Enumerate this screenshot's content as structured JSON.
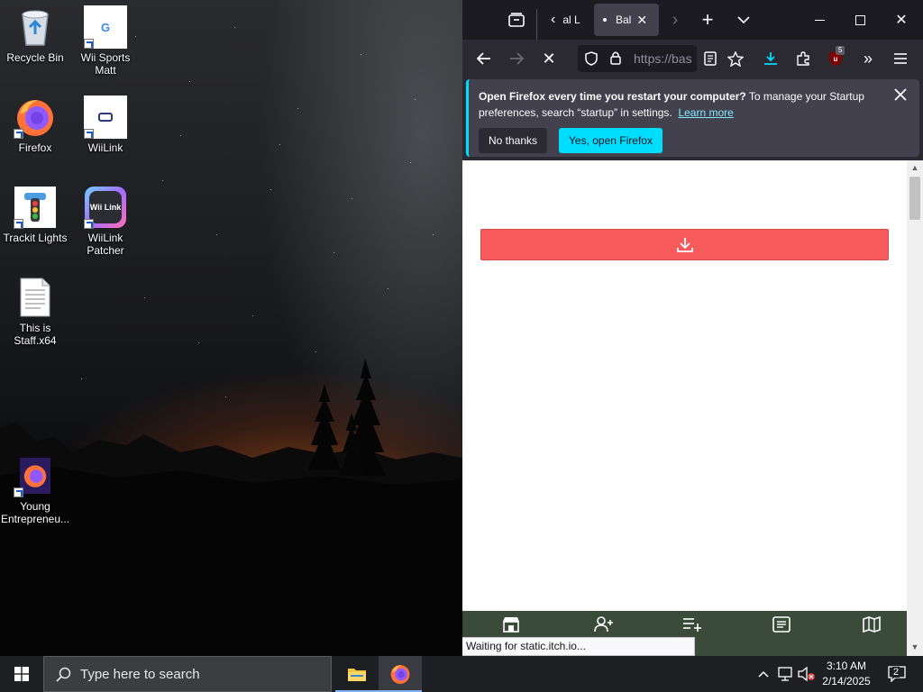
{
  "desktop": {
    "icons": [
      {
        "label": "Recycle Bin"
      },
      {
        "label": "Wii Sports Matt"
      },
      {
        "label": "Firefox"
      },
      {
        "label": "WiiLink"
      },
      {
        "label": "Trackit Lights"
      },
      {
        "label": "WiiLink Patcher"
      },
      {
        "label": "This is Staff.x64"
      },
      {
        "label": "Young Entrepreneu..."
      }
    ],
    "wiilink_logo_text": "Wii Link"
  },
  "browser": {
    "tabs": [
      {
        "label": "al L"
      },
      {
        "label": "Bal"
      }
    ],
    "url": "https://bas",
    "extension_badge": "5",
    "notification": {
      "title": "Open Firefox every time you restart your computer?",
      "body": " To manage your Startup preferences, search “startup” in settings.",
      "link": "Learn more",
      "no_label": "No thanks",
      "yes_label": "Yes, open Firefox"
    },
    "status_text": "Waiting for static.itch.io...",
    "colors": {
      "download_bar": "#f75b5b",
      "accent": "#00ddff",
      "bottom_nav": "#3a4b3a"
    }
  },
  "taskbar": {
    "search_placeholder": "Type here to search",
    "time": "3:10 AM",
    "date": "2/14/2025",
    "notification_count": "2"
  }
}
